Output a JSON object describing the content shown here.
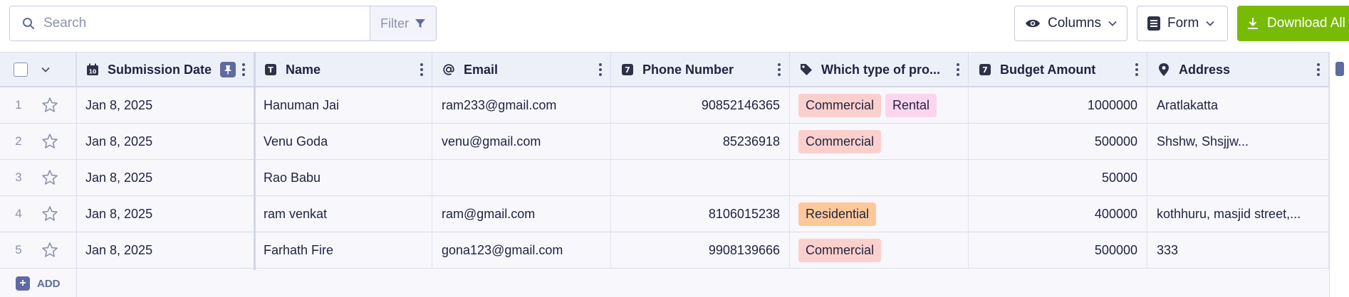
{
  "toolbar": {
    "search_placeholder": "Search",
    "filter_label": "Filter",
    "columns_label": "Columns",
    "form_label": "Form",
    "download_label": "Download All"
  },
  "colors": {
    "accent_green": "#78bb07",
    "primary_indigo": "#5f6aa3",
    "tag_commercial": "#fbd0cc",
    "tag_rental": "#fbd6ec",
    "tag_residential": "#fdc99a"
  },
  "table": {
    "columns": [
      {
        "label": "Submission Date",
        "icon": "calendar-icon",
        "pinned": true
      },
      {
        "label": "Name",
        "icon": "text-type-icon"
      },
      {
        "label": "Email",
        "icon": "at-sign-icon"
      },
      {
        "label": "Phone Number",
        "icon": "number-type-icon"
      },
      {
        "label": "Which type of pro...",
        "icon": "tag-icon"
      },
      {
        "label": "Budget Amount",
        "icon": "number-type-icon"
      },
      {
        "label": "Address",
        "icon": "location-pin-icon"
      }
    ],
    "rows": [
      {
        "num": "1",
        "date": "Jan 8, 2025",
        "name": "Hanuman Jai",
        "email": "ram233@gmail.com",
        "phone": "90852146365",
        "types": [
          "Commercial",
          "Rental"
        ],
        "budget": "1000000",
        "address": "Aratlakatta"
      },
      {
        "num": "2",
        "date": "Jan 8, 2025",
        "name": "Venu Goda",
        "email": "venu@gmail.com",
        "phone": "85236918",
        "types": [
          "Commercial"
        ],
        "budget": "500000",
        "address": "Shshw, Shsjjw..."
      },
      {
        "num": "3",
        "date": "Jan 8, 2025",
        "name": "Rao Babu",
        "email": "",
        "phone": "",
        "types": [],
        "budget": "50000",
        "address": ""
      },
      {
        "num": "4",
        "date": "Jan 8, 2025",
        "name": "ram venkat",
        "email": "ram@gmail.com",
        "phone": "8106015238",
        "types": [
          "Residential"
        ],
        "budget": "400000",
        "address": "kothhuru, masjid street,..."
      },
      {
        "num": "5",
        "date": "Jan 8, 2025",
        "name": "Farhath Fire",
        "email": "gona123@gmail.com",
        "phone": "9908139666",
        "types": [
          "Commercial"
        ],
        "budget": "500000",
        "address": "333"
      }
    ],
    "add_label": "ADD"
  }
}
